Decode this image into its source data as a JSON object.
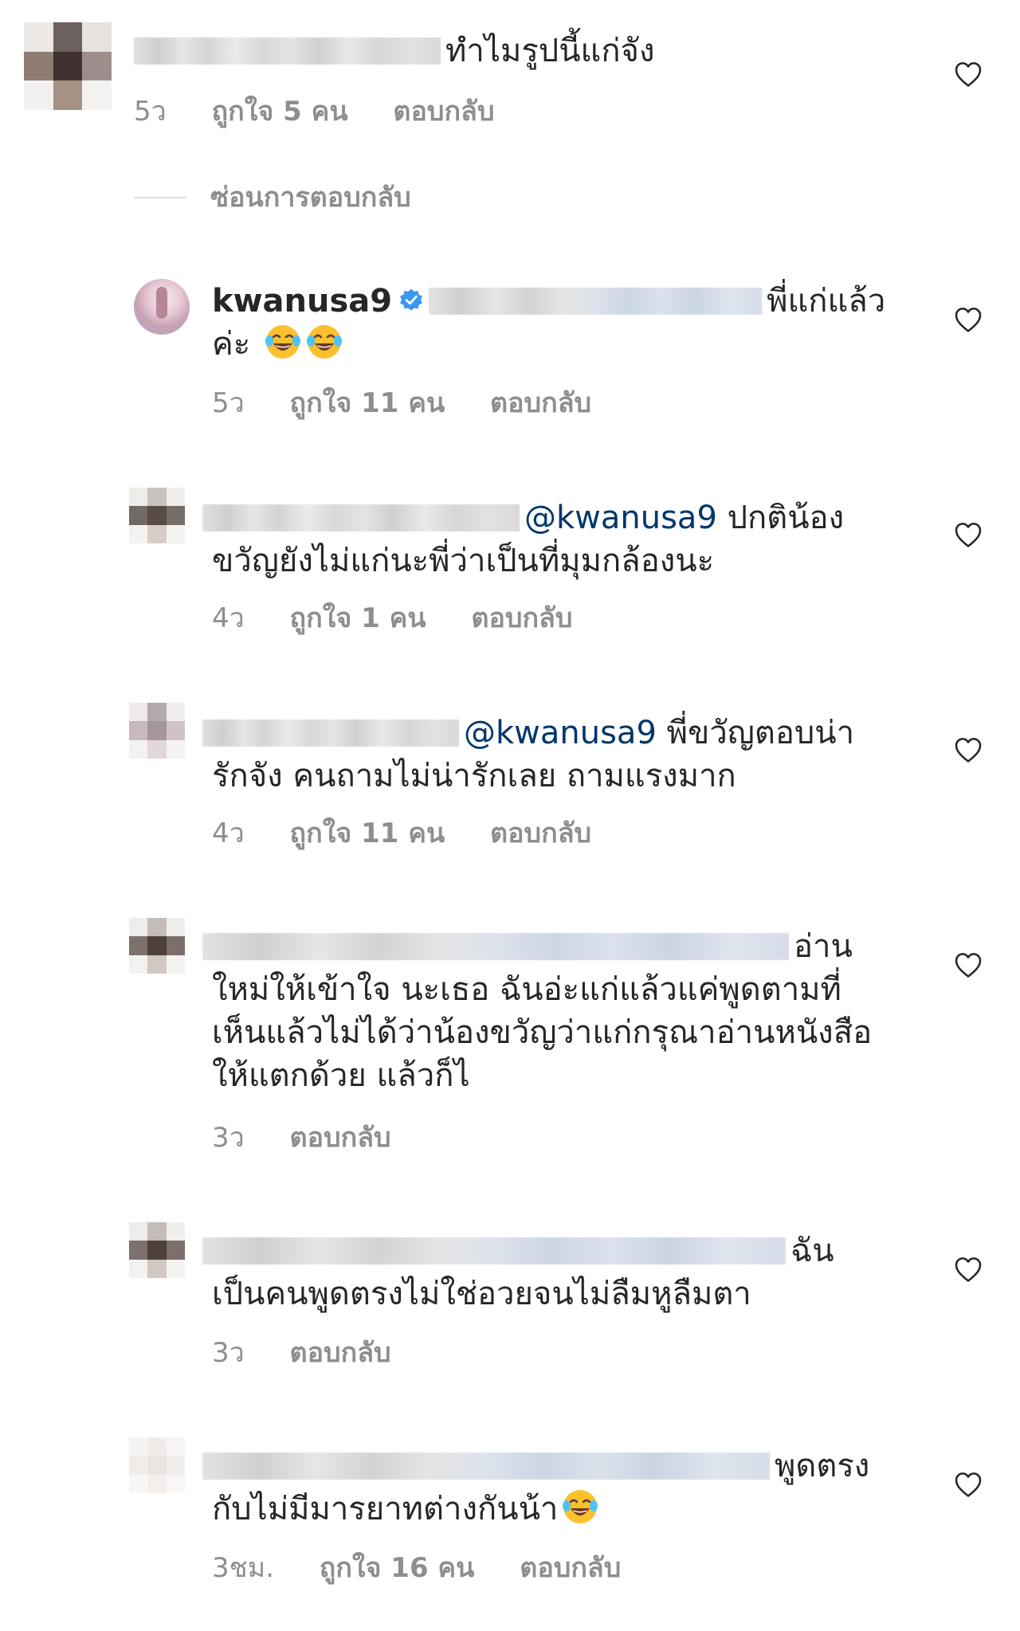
{
  "icons": {
    "like": "heart-outline-icon",
    "verified": "verified-badge-icon",
    "emoji": "face-with-tears-of-joy-emoji"
  },
  "colors": {
    "mention": "#00376b",
    "meta": "#8e8e8e",
    "text": "#262626",
    "verified": "#3897f0"
  },
  "hide_replies_label": "ซ่อนการตอบกลับ",
  "comments": [
    {
      "text_lines": [
        "ทำไมรูปนี้แก่จัง"
      ],
      "time": "5ว",
      "likes": "ถูกใจ 5 คน",
      "reply": "ตอบกลับ"
    },
    {
      "username": "kwanusa9",
      "text_lines": [
        "พี่แก่แล้ว",
        "ค่ะ"
      ],
      "time": "5ว",
      "likes": "ถูกใจ 11 คน",
      "reply": "ตอบกลับ"
    },
    {
      "mention": "@kwanusa9",
      "text_lines": [
        "ปกติน้อง",
        "ขวัญยังไม่แก่นะพี่ว่าเป็นที่มุมกล้องนะ"
      ],
      "time": "4ว",
      "likes": "ถูกใจ 1 คน",
      "reply": "ตอบกลับ"
    },
    {
      "mention": "@kwanusa9",
      "text_lines": [
        "พี่ขวัญตอบน่า",
        "รักจัง คนถามไม่น่ารักเลย ถามแรงมาก"
      ],
      "time": "4ว",
      "likes": "ถูกใจ 11 คน",
      "reply": "ตอบกลับ"
    },
    {
      "text_lines": [
        "อ่าน",
        "ใหม่ให้เข้าใจ นะเธอ ฉันอ่ะแก่แล้วแค่พูดตามที่",
        "เห็นแล้วไม่ได้ว่าน้องขวัญว่าแก่กรุณาอ่านหนังสือ",
        "ให้แตกด้วย แล้วก็ไ"
      ],
      "time": "3ว",
      "reply": "ตอบกลับ"
    },
    {
      "text_lines": [
        "ฉัน",
        "เป็นคนพูดตรงไม่ใช่อวยจนไม่ลืมหูลืมตา"
      ],
      "time": "3ว",
      "reply": "ตอบกลับ"
    },
    {
      "text_lines": [
        "พูดตรง",
        "กับไม่มีมารยาทต่างกันน้า"
      ],
      "time": "3ชม.",
      "likes": "ถูกใจ 16 คน",
      "reply": "ตอบกลับ"
    }
  ]
}
